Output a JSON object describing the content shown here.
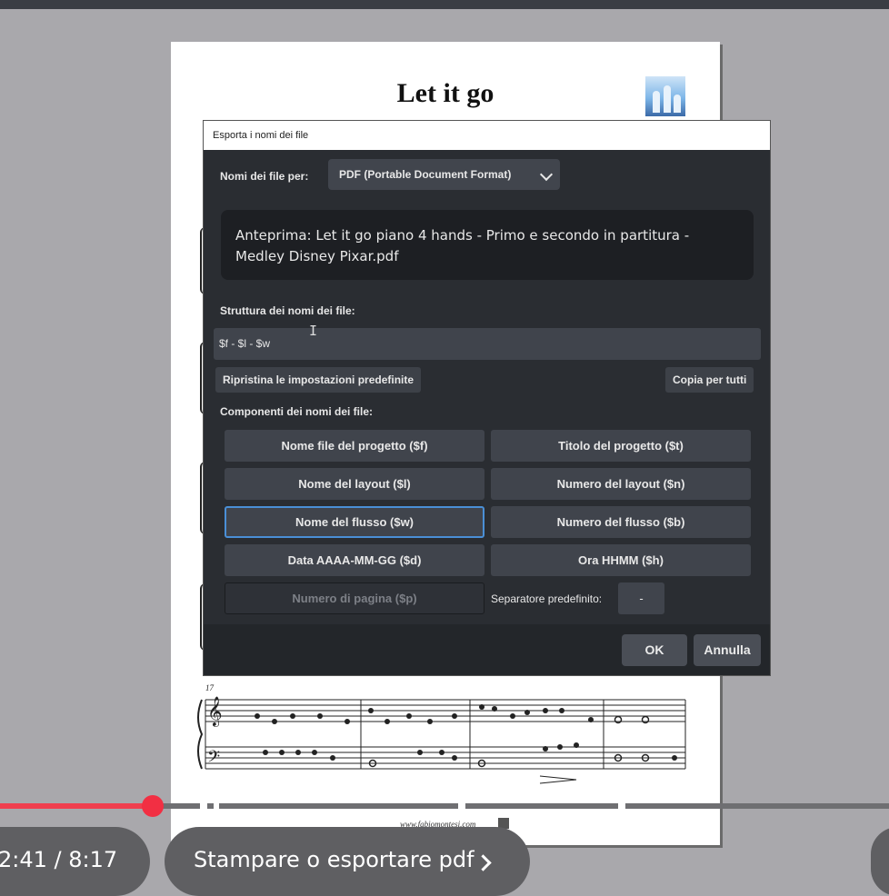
{
  "score": {
    "title": "Let it go",
    "measure_number": "17",
    "footer": "www.fabiomontesi.com"
  },
  "dialog": {
    "title": "Esporta i nomi dei file",
    "filenames_for_label": "Nomi dei file per:",
    "format_select_value": "PDF (Portable Document Format)",
    "preview_text": "Anteprima: Let it go piano 4 hands - Primo e secondo in partitura - Medley Disney Pixar.pdf",
    "structure_label": "Struttura dei nomi dei file:",
    "structure_value": "$f - $l - $w",
    "reset_button": "Ripristina le impostazioni predefinite",
    "copy_all_button": "Copia per tutti",
    "components_label": "Componenti dei nomi dei file:",
    "components": [
      "Nome file del progetto ($f)",
      "Titolo del progetto ($t)",
      "Nome del layout ($l)",
      "Numero del layout ($n)",
      "Nome del flusso ($w)",
      "Numero del flusso ($b)",
      "Data AAAA-MM-GG ($d)",
      "Ora HHMM ($h)",
      "Numero di pagina ($p)"
    ],
    "separator_label": "Separatore predefinito:",
    "separator_value": "-",
    "ok_button": "OK",
    "cancel_button": "Annulla"
  },
  "player": {
    "time": "2:41 / 8:17",
    "chapter": "Stampare o esportare pdf",
    "progress_played_fraction": 0.171,
    "colors": {
      "played": "#f03f4e",
      "buffered": "#6f6f72"
    }
  }
}
